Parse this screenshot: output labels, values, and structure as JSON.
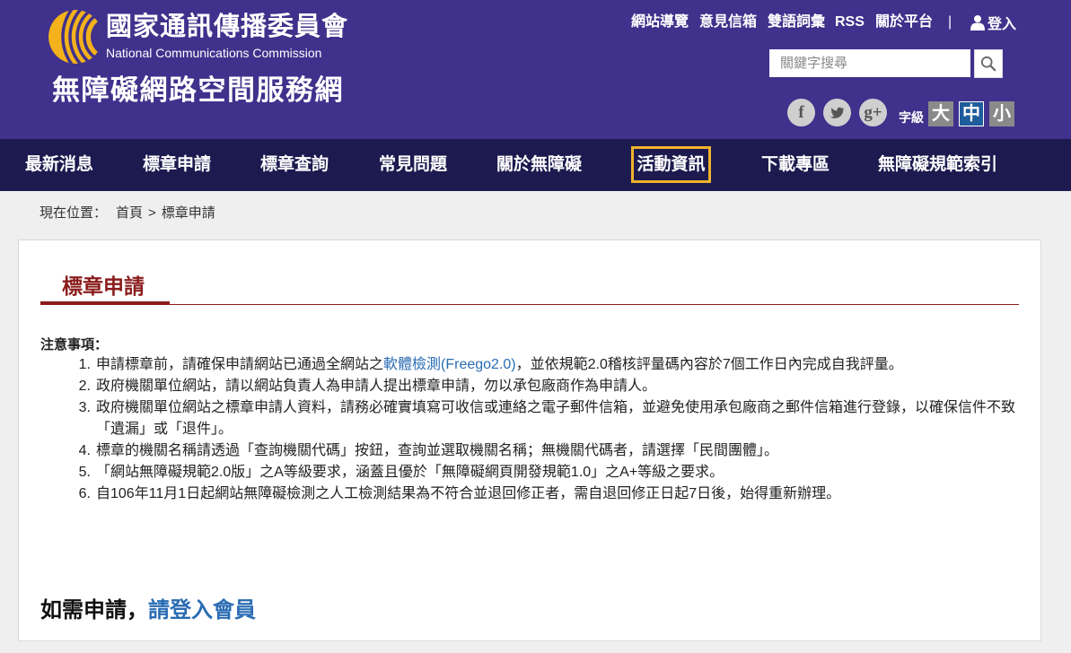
{
  "header": {
    "org_name_zh": "國家通訊傳播委員會",
    "org_name_en": "National Communications Commission",
    "site_title": "無障礙網路空間服務網",
    "logo_icon": "ncc-logo-icon",
    "top_links": [
      {
        "label": "網站導覽"
      },
      {
        "label": "意見信箱"
      },
      {
        "label": "雙語詞彙"
      },
      {
        "label": "RSS"
      },
      {
        "label": "關於平台"
      }
    ],
    "separator": "|",
    "login": {
      "icon": "user-icon",
      "label": "登入"
    },
    "search": {
      "placeholder": "關鍵字搜尋",
      "value": "",
      "button_icon": "search-icon"
    },
    "social": [
      {
        "icon": "facebook-icon",
        "glyph": "f"
      },
      {
        "icon": "twitter-icon"
      },
      {
        "icon": "google-plus-icon",
        "glyph": "g+"
      }
    ],
    "font_size": {
      "label": "字級",
      "options": [
        {
          "label": "大",
          "selected": false
        },
        {
          "label": "中",
          "selected": true
        },
        {
          "label": "小",
          "selected": false
        }
      ]
    }
  },
  "nav": {
    "items": [
      {
        "label": "最新消息"
      },
      {
        "label": "標章申請"
      },
      {
        "label": "標章查詢"
      },
      {
        "label": "常見問題"
      },
      {
        "label": "關於無障礙"
      },
      {
        "label": "活動資訊",
        "focused": true
      },
      {
        "label": "下載專區"
      },
      {
        "label": "無障礙規範索引"
      }
    ]
  },
  "breadcrumb": {
    "prefix": "現在位置：",
    "home": "首頁",
    "separator": ">",
    "current": "標章申請"
  },
  "content": {
    "title": "標章申請",
    "notice_heading": "注意事項：",
    "notices": [
      {
        "number": "1.",
        "text": "申請標章前，請確保申請網站已通過全網站之",
        "link": "軟體檢測(Freego2.0)",
        "text_after": "，並依規範2.0稽核評量碼內容於7個工作日內完成自我評量。"
      },
      {
        "number": "2.",
        "text": "政府機關單位網站，請以網站負責人為申請人提出標章申請，勿以承包廠商作為申請人。"
      },
      {
        "number": "3.",
        "text": "政府機關單位網站之標章申請人資料，請務必確實填寫可收信或連絡之電子郵件信箱，並避免使用承包廠商之郵件信箱進行登錄，以確保信件不致「遺漏」或「退件」。"
      },
      {
        "number": "4.",
        "text": "標章的機關名稱請透過「查詢機關代碼」按鈕，查詢並選取機關名稱；無機關代碼者，請選擇「民間團體」。"
      },
      {
        "number": "5.",
        "text": "「網站無障礙規範2.0版」之A等級要求，涵蓋且優於「無障礙網頁開發規範1.0」之A+等級之要求。"
      },
      {
        "number": "6.",
        "text": "自106年11月1日起網站無障礙檢測之人工檢測結果為不符合並退回修正者，需自退回修正日起7日後，始得重新辦理。"
      }
    ],
    "apply": {
      "text": "如需申請，",
      "link": "請登入會員"
    }
  },
  "colors": {
    "header_bg": "#40318c",
    "nav_bg": "#1c1a4e",
    "title": "#8b1c1c",
    "link": "#2a6cb3",
    "focus": "#f2b22c",
    "active_size": "#1f5c9c",
    "size_btn": "#8a8a8a",
    "page_bg": "#efefef"
  }
}
